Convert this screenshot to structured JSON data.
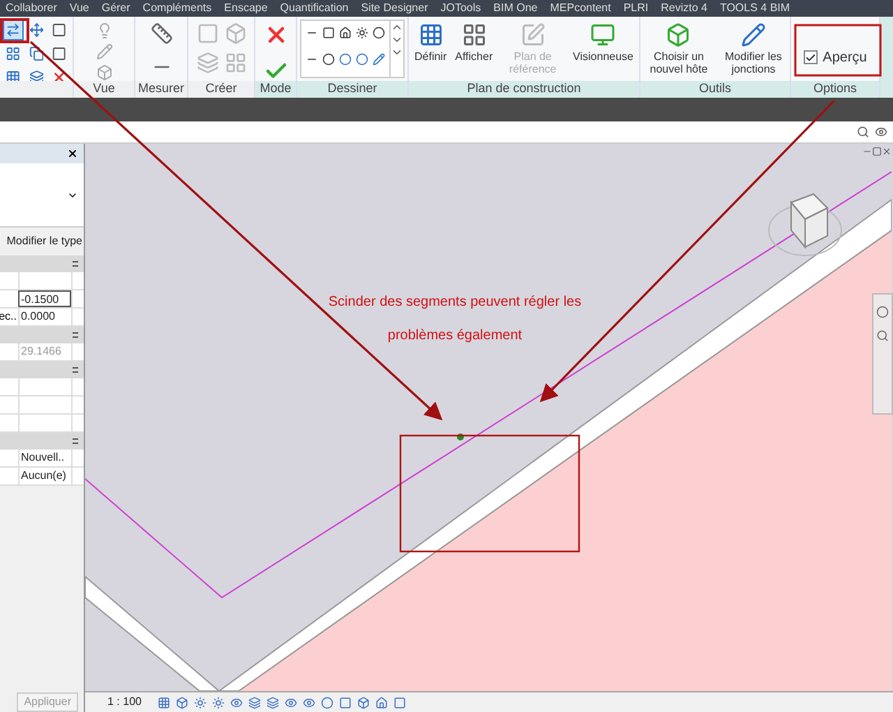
{
  "menu_tabs": [
    "Collaborer",
    "Vue",
    "Gérer",
    "Compléments",
    "Enscape",
    "Quantification",
    "Site Designer",
    "JOTools",
    "BIM One",
    "MEPcontent",
    "PLRI",
    "Revizto 4",
    "TOOLS 4 BIM"
  ],
  "ribbon": {
    "panels": [
      {
        "kind": "modify"
      },
      {
        "kind": "view",
        "label": "Vue"
      },
      {
        "kind": "measure",
        "label": "Mesurer"
      },
      {
        "kind": "create",
        "label": "Créer"
      },
      {
        "kind": "mode",
        "label": "Mode"
      },
      {
        "kind": "draw",
        "label": "Dessiner"
      },
      {
        "kind": "workplane",
        "label": "Plan de construction"
      },
      {
        "kind": "tools",
        "label": "Outils"
      },
      {
        "kind": "options",
        "label": "Options"
      }
    ],
    "workplane_buttons": [
      {
        "label": "Définir",
        "disabled": false
      },
      {
        "label": "Afficher",
        "disabled": false
      },
      {
        "label": "Plan de référence",
        "disabled": true
      },
      {
        "label": "Visionneuse",
        "disabled": false
      }
    ],
    "tool_buttons": [
      {
        "label": "Choisir un nouvel hôte"
      },
      {
        "label": "Modifier les jonctions"
      }
    ],
    "preview": {
      "label": "Aperçu",
      "checked": true
    }
  },
  "properties": {
    "type_button": "Modifier le type",
    "rows": [
      {
        "kind": "header"
      },
      {
        "kind": "row",
        "label": "",
        "value": "",
        "editing": false
      },
      {
        "kind": "row",
        "label": "",
        "value": "-0.1500",
        "editing": true,
        "disabled": false
      },
      {
        "kind": "row",
        "label": "ec..",
        "value": "0.0000",
        "editing": false,
        "disabled": false
      },
      {
        "kind": "header"
      },
      {
        "kind": "row",
        "label": "",
        "value": "29.1466",
        "editing": false,
        "disabled": true
      },
      {
        "kind": "header"
      },
      {
        "kind": "row",
        "label": "",
        "value": "",
        "editing": false
      },
      {
        "kind": "row",
        "label": "",
        "value": "",
        "editing": false
      },
      {
        "kind": "row",
        "label": "",
        "value": "",
        "editing": false
      },
      {
        "kind": "header"
      },
      {
        "kind": "row",
        "label": "",
        "value": "Nouvell..",
        "editing": false,
        "disabled": false
      },
      {
        "kind": "row",
        "label": "",
        "value": "Aucun(e)",
        "editing": false,
        "disabled": false
      }
    ],
    "apply": "Appliquer"
  },
  "annotation": {
    "text": "Scinder des segments peuvent régler les problèmes également"
  },
  "status_bar": {
    "scale": "1 : 100"
  }
}
